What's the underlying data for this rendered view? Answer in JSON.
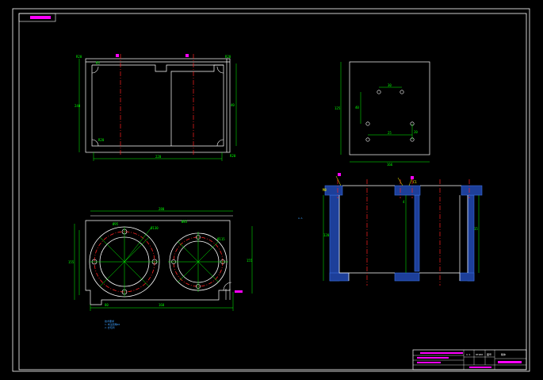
{
  "colors": {
    "background": "#000000",
    "outline": "#ffffff",
    "dimension": "#00ff00",
    "centerline": "#ff2020",
    "hatch": "#3a6ee0",
    "label_mark": "#ff00ff",
    "leader": "#ffff00"
  },
  "drawing": {
    "top_view": {
      "dims": {
        "overall_width": "220",
        "overall_height": "240",
        "right_height": "40",
        "corner_left_top": "R20",
        "corner_right_top": "R20",
        "corner_left_bottom": "R20",
        "corner_right_bottom": "R20",
        "radius_note": "R5"
      }
    },
    "side_view": {
      "dims": {
        "width": "166",
        "height": "125",
        "hole_x1": "30",
        "hole_x2": "25",
        "hole_y1": "40",
        "hole_y2": "20"
      }
    },
    "plan_view": {
      "dims": {
        "overall_width": "280",
        "left_bore": "Ø95",
        "right_bore": "Ø85",
        "pcd_left": "Ø130",
        "pcd_right": "Ø115",
        "height_left": "155",
        "height_right": "155",
        "bottom_left": "80",
        "bottom_right": "160"
      }
    },
    "section_view": {
      "dims": {
        "depth": "120",
        "wall": "15",
        "thread": "M8",
        "chamfer": "C1",
        "bottom": "4"
      }
    },
    "notes": {
      "line1": "技术要求",
      "line2": "1.未注圆角R2",
      "line3": "2.去毛刺"
    },
    "side_label": "A-A"
  },
  "title_block": {
    "part_name": "箱体",
    "scale": "1:1",
    "material": "HT200",
    "sheet": "图号"
  }
}
